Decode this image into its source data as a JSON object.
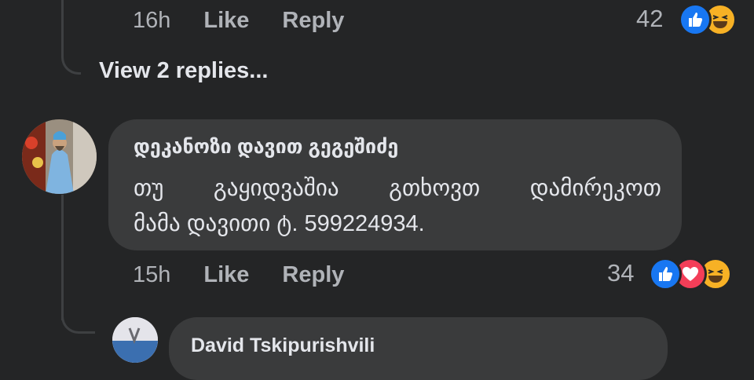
{
  "top_comment": {
    "time": "16h",
    "like_label": "Like",
    "reply_label": "Reply",
    "reaction_count": "42",
    "reactions": [
      "like-icon",
      "haha-icon"
    ]
  },
  "view_replies": "View 2 replies...",
  "comment": {
    "author": "დეკანოზი დავით გეგეშიძე",
    "text_line1_words": [
      "თუ",
      "გაყიდვაშია",
      "გთხოვთ",
      "დამირეკოთ"
    ],
    "text_line2": "მამა დავითი ტ. 599224934.",
    "time": "15h",
    "like_label": "Like",
    "reply_label": "Reply",
    "reaction_count": "34",
    "reactions": [
      "like-icon",
      "love-icon",
      "haha-icon"
    ]
  },
  "reply": {
    "author": "David Tskipurishvili"
  },
  "colors": {
    "background": "#242526",
    "bubble": "#3a3b3c",
    "text": "#e4e6eb",
    "secondary": "#b0b3b8",
    "like_blue": "#1877f2",
    "love_red": "#f33e58",
    "haha_yellow": "#f7b125"
  }
}
